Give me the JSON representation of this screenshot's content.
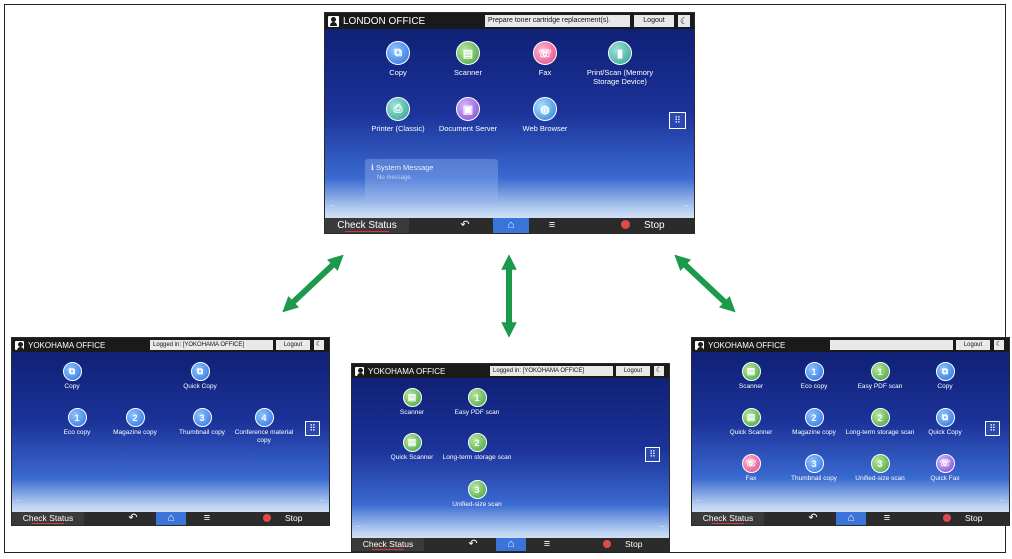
{
  "main": {
    "office": "LONDON OFFICE",
    "message": "Prepare toner cartridge replacement(s).",
    "logout": "Logout",
    "apps": [
      "Copy",
      "Scanner",
      "Fax",
      "Print/Scan (Memory Storage Device)",
      "Printer (Classic)",
      "Document Server",
      "Web Browser"
    ],
    "system_message_title": "System Message",
    "system_message_body": "No message."
  },
  "left": {
    "office": "YOKOHAMA OFFICE",
    "message": "Logged in: [YOKOHAMA OFFICE]",
    "logout": "Logout",
    "apps": [
      "Copy",
      "Quick Copy",
      "Eco copy",
      "Magazine copy",
      "Thumbnail copy",
      "Conference material copy"
    ]
  },
  "middle": {
    "office": "YOKOHAMA OFFICE",
    "message": "Logged in: [YOKOHAMA OFFICE]",
    "logout": "Logout",
    "apps": [
      "Scanner",
      "Easy PDF scan",
      "Quick Scanner",
      "Long-term storage scan",
      "Unified-size scan"
    ]
  },
  "right": {
    "office": "YOKOHAMA OFFICE",
    "message": "",
    "logout": "Logout",
    "apps": [
      "Scanner",
      "Eco copy",
      "Easy PDF scan",
      "Copy",
      "Quick Scanner",
      "Magazine copy",
      "Long-term storage scan",
      "Quick Copy",
      "Fax",
      "Thumbnail copy",
      "Unified-size scan",
      "Quick Fax"
    ]
  },
  "bar": {
    "check_status": "Check Status",
    "stop": "Stop"
  },
  "icons": {
    "user": "user-icon",
    "moon": "energy-saver-icon",
    "back": "back-arrow-icon",
    "home": "home-icon",
    "menu": "menu-icon",
    "stop": "stop-icon",
    "grid": "app-list-icon",
    "info": "info-icon"
  },
  "colors": {
    "arrow": "#1a9a4a",
    "home_button": "#3a74d8"
  }
}
